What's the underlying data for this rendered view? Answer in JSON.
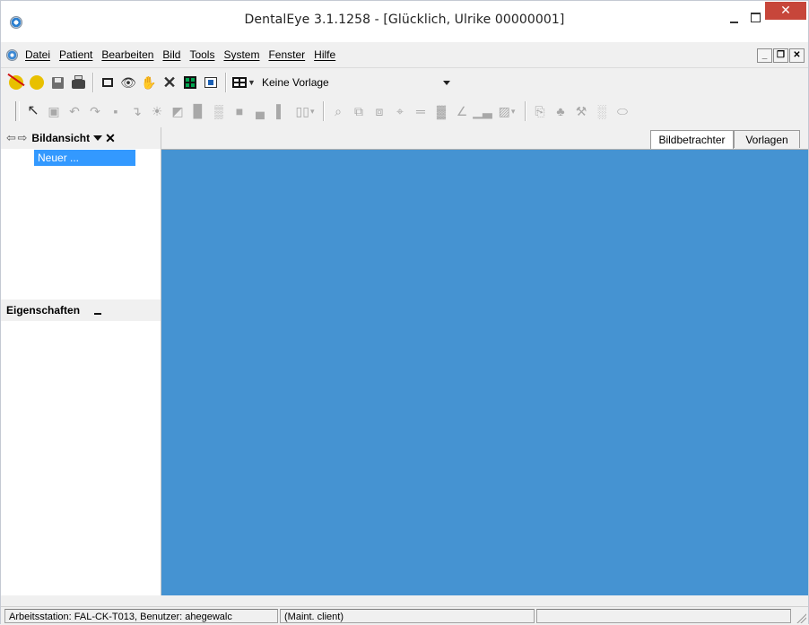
{
  "window": {
    "title": "DentalEye 3.1.1258 - [Glücklich, Ulrike  00000001]",
    "close_glyph": "✕"
  },
  "menu": {
    "items": [
      "Datei",
      "Patient",
      "Bearbeiten",
      "Bild",
      "Tools",
      "System",
      "Fenster",
      "Hilfe"
    ],
    "mdi_minimize": "_",
    "mdi_restore": "❐",
    "mdi_close": "✕"
  },
  "toolbar": {
    "template_label": "Keine Vorlage"
  },
  "left_panel": {
    "title": "Bildansicht",
    "nav_glyph": "⇦ ⇨",
    "close_glyph": "✕",
    "tree_item": "Neuer ...",
    "properties_title": "Eigenschaften"
  },
  "tabs": [
    "Bildbetrachter",
    "Vorlagen"
  ],
  "status": {
    "workstation": "Arbeitsstation: FAL-CK-T013, Benutzer: ahegewalc",
    "mode": "(Maint. client)",
    "extra": ""
  },
  "colors": {
    "image_area": "#4593d2",
    "selection": "#3399ff",
    "close_button": "#c7463a"
  },
  "icons": [
    "patient-remove-icon",
    "patient-add-icon",
    "save-icon",
    "print-icon",
    "new-window-icon",
    "binoculars-icon",
    "hand-icon",
    "delete-icon",
    "grid-icon",
    "import-icon",
    "layout-icon",
    "select-icon",
    "capture-icon",
    "undo-icon",
    "redo-icon",
    "rotate-icon",
    "brightness-icon",
    "contrast-icon",
    "zoom-icon",
    "measure-icon",
    "angle-icon",
    "histogram-icon"
  ]
}
